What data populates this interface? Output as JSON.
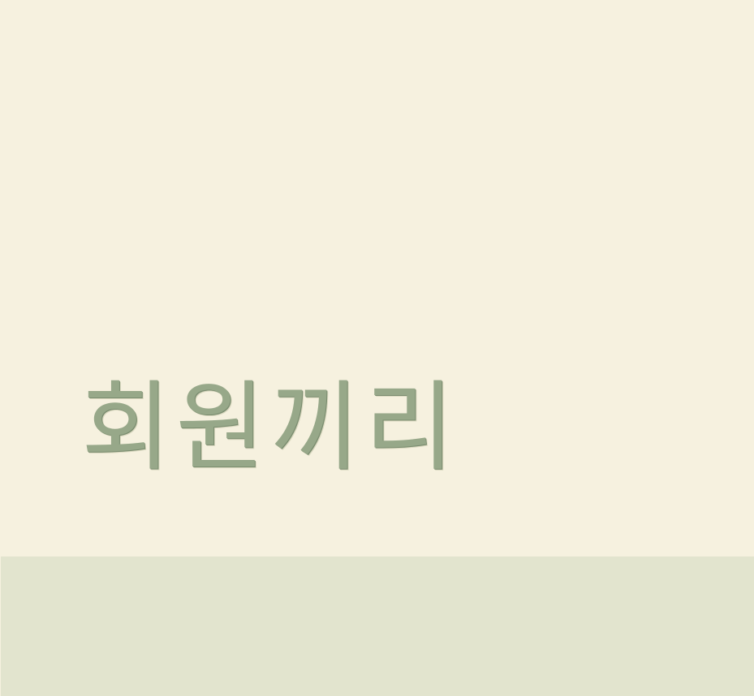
{
  "title": "회원끼리",
  "colors": {
    "background": "#f6f1df",
    "title_text": "#97a889",
    "bottom_band": "#e2e4ce"
  }
}
